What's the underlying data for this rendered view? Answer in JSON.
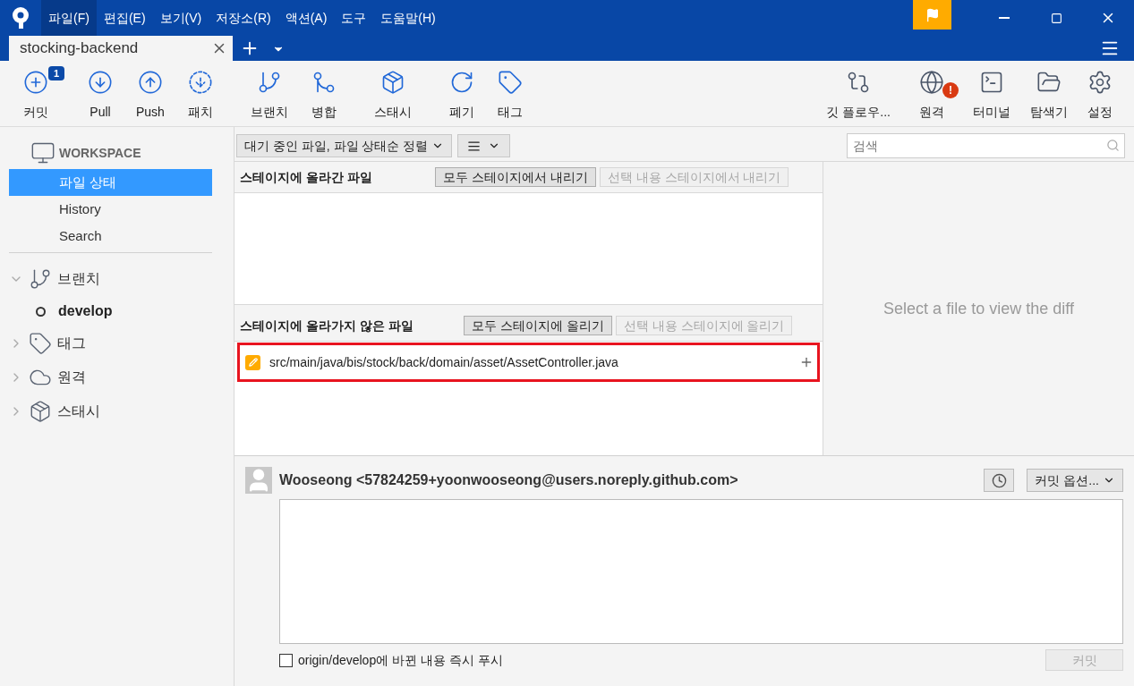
{
  "menu": [
    {
      "label": "파일(F)",
      "selected": true
    },
    {
      "label": "편집(E)",
      "selected": false
    },
    {
      "label": "보기(V)",
      "selected": false
    },
    {
      "label": "저장소(R)",
      "selected": false
    },
    {
      "label": "액션(A)",
      "selected": false
    },
    {
      "label": "도구",
      "selected": false
    },
    {
      "label": "도움말(H)",
      "selected": false
    }
  ],
  "tabs": [
    {
      "label": "stocking-backend",
      "selected": true
    }
  ],
  "toolbar_left": [
    {
      "label": "커밋",
      "kind": "commit",
      "badge": {
        "text": "1",
        "kind": "count"
      }
    },
    {
      "label": "Pull",
      "kind": "pull"
    },
    {
      "label": "Push",
      "kind": "push"
    },
    {
      "label": "패치",
      "kind": "fetch"
    },
    {
      "label": "브랜치",
      "kind": "branch"
    },
    {
      "label": "병합",
      "kind": "merge"
    },
    {
      "label": "스태시",
      "kind": "stash"
    },
    {
      "label": "폐기",
      "kind": "discard"
    },
    {
      "label": "태그",
      "kind": "tag"
    }
  ],
  "toolbar_right": [
    {
      "label": "깃 플로우...",
      "kind": "flow"
    },
    {
      "label": "원격",
      "kind": "remote",
      "badge": {
        "text": "!",
        "kind": "alert"
      }
    },
    {
      "label": "터미널",
      "kind": "terminal"
    },
    {
      "label": "탐색기",
      "kind": "explorer"
    },
    {
      "label": "설정",
      "kind": "settings"
    }
  ],
  "sidebar": {
    "workspace": {
      "title": "WORKSPACE",
      "items": [
        {
          "label": "파일 상태",
          "selected": true
        },
        {
          "label": "History",
          "selected": false
        },
        {
          "label": "Search",
          "selected": false
        }
      ]
    },
    "sections": [
      {
        "label": "브랜치",
        "kind": "branch",
        "expanded": true,
        "children": [
          {
            "label": "develop",
            "current": true
          }
        ]
      },
      {
        "label": "태그",
        "kind": "tag",
        "expanded": false
      },
      {
        "label": "원격",
        "kind": "cloud",
        "expanded": false
      },
      {
        "label": "스태시",
        "kind": "stash",
        "expanded": false
      }
    ]
  },
  "filter": {
    "label": "대기 중인 파일, 파일 상태순 정렬"
  },
  "search": {
    "placeholder": "검색"
  },
  "staged": {
    "title": "스테이지에 올라간 파일",
    "buttons": [
      {
        "label": "모두 스테이지에서 내리기",
        "disabled": false
      },
      {
        "label": "선택 내용 스테이지에서 내리기",
        "disabled": true
      }
    ]
  },
  "unstaged": {
    "title": "스테이지에 올라가지 않은 파일",
    "buttons": [
      {
        "label": "모두 스테이지에 올리기",
        "disabled": false
      },
      {
        "label": "선택 내용 스테이지에 올리기",
        "disabled": true
      }
    ],
    "files": [
      {
        "path": "src/main/java/bis/stock/back/domain/asset/AssetController.java",
        "highlighted": true
      }
    ]
  },
  "diff": {
    "message": "Select a file to view the diff"
  },
  "commit": {
    "author": "Wooseong <57824259+yoonwooseong@users.noreply.github.com>",
    "options": "커밋 옵션...",
    "push": {
      "label": "origin/develop에 바뀐 내용 즉시 푸시",
      "checked": false
    },
    "button": {
      "label": "커밋",
      "disabled": true
    }
  }
}
